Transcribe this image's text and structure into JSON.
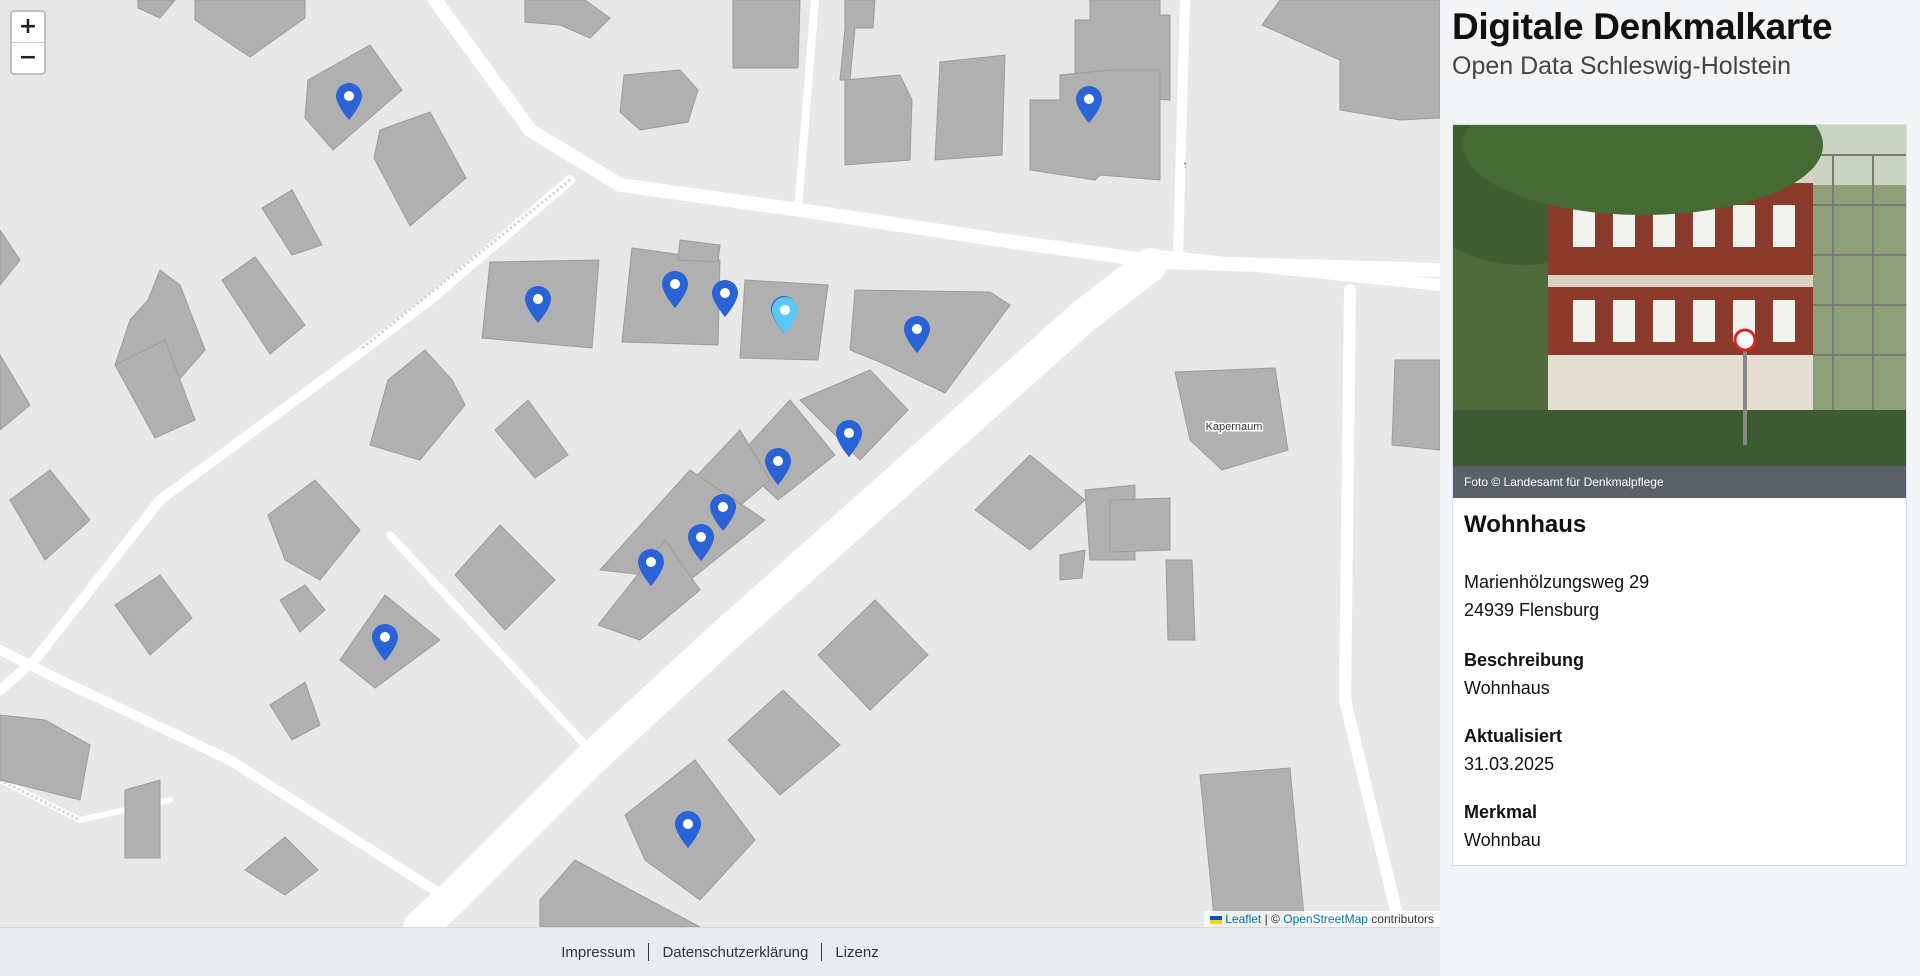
{
  "header": {
    "title": "Digitale Denkmalkarte",
    "subtitle": "Open Data Schleswig-Holstein"
  },
  "map": {
    "zoom_in": "+",
    "zoom_out": "−",
    "building_label": "Kapernaum",
    "attribution": {
      "leaflet": "Leaflet",
      "separator": "| ©",
      "osm": "OpenStreetMap",
      "suffix": "contributors"
    },
    "marker_count": 15,
    "selected_marker_color": "#5ac8f0",
    "marker_color": "#2a63d6"
  },
  "detail": {
    "photo_caption": "Foto © Landesamt für Denkmalpflege",
    "name": "Wohnhaus",
    "address_line1": "Marienhölzungsweg 29",
    "address_line2": "24939 Flensburg",
    "fields": [
      {
        "label": "Beschreibung",
        "value": "Wohnhaus"
      },
      {
        "label": "Aktualisiert",
        "value": "31.03.2025"
      },
      {
        "label": "Merkmal",
        "value": "Wohnbau"
      }
    ]
  },
  "footer": {
    "links": [
      "Impressum",
      "Datenschutzerklärung",
      "Lizenz"
    ]
  }
}
